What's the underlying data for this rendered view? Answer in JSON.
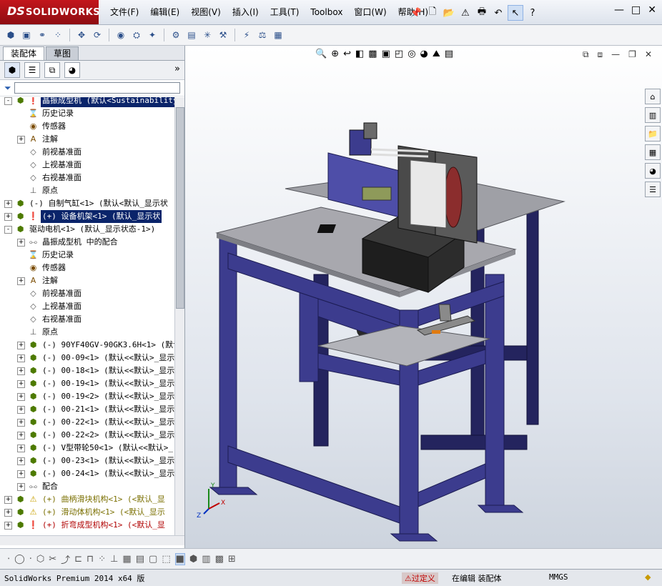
{
  "titlebar": {
    "logo_ds": "DS",
    "logo_text": "SOLIDWORKS",
    "menu": [
      "文件(F)",
      "编辑(E)",
      "视图(V)",
      "插入(I)",
      "工具(T)",
      "Toolbox",
      "窗口(W)",
      "帮助(H)"
    ],
    "window_controls": [
      "—",
      "□",
      "✕"
    ]
  },
  "left_panel": {
    "tabs": [
      "装配体",
      "草图"
    ],
    "more_label": "»",
    "tree": [
      {
        "label": "晶振成型机  (默认<Sustainability",
        "icon": "assembly",
        "expand": "-",
        "indent": 0,
        "selected": true,
        "status": "error"
      },
      {
        "label": "历史记录",
        "icon": "history",
        "expand": "",
        "indent": 1
      },
      {
        "label": "传感器",
        "icon": "sensor",
        "expand": "",
        "indent": 1
      },
      {
        "label": "注解",
        "icon": "annotation",
        "expand": "+",
        "indent": 1
      },
      {
        "label": "前视基准面",
        "icon": "plane",
        "expand": "",
        "indent": 1
      },
      {
        "label": "上视基准面",
        "icon": "plane",
        "expand": "",
        "indent": 1
      },
      {
        "label": "右视基准面",
        "icon": "plane",
        "expand": "",
        "indent": 1
      },
      {
        "label": "原点",
        "icon": "origin",
        "expand": "",
        "indent": 1
      },
      {
        "label": "(-) 自制气缸<1> (默认<默认_显示状",
        "icon": "part",
        "expand": "+",
        "indent": 0
      },
      {
        "label": "(+) 设备机架<1> (默认_显示状",
        "icon": "part",
        "expand": "+",
        "indent": 0,
        "selected": true,
        "status": "error"
      },
      {
        "label": "驱动电机<1> (默认_显示状态-1>)",
        "icon": "part",
        "expand": "-",
        "indent": 0
      },
      {
        "label": "晶振成型机 中的配合",
        "icon": "mates",
        "expand": "+",
        "indent": 1
      },
      {
        "label": "历史记录",
        "icon": "history",
        "expand": "",
        "indent": 1
      },
      {
        "label": "传感器",
        "icon": "sensor",
        "expand": "",
        "indent": 1
      },
      {
        "label": "注解",
        "icon": "annotation",
        "expand": "+",
        "indent": 1
      },
      {
        "label": "前视基准面",
        "icon": "plane",
        "expand": "",
        "indent": 1
      },
      {
        "label": "上视基准面",
        "icon": "plane",
        "expand": "",
        "indent": 1
      },
      {
        "label": "右视基准面",
        "icon": "plane",
        "expand": "",
        "indent": 1
      },
      {
        "label": "原点",
        "icon": "origin",
        "expand": "",
        "indent": 1
      },
      {
        "label": "(-) 90YF40GV-90GK3.6H<1> (默认",
        "icon": "part",
        "expand": "+",
        "indent": 1
      },
      {
        "label": "(-) 00-09<1> (默认<<默认>_显示",
        "icon": "part",
        "expand": "+",
        "indent": 1
      },
      {
        "label": "(-) 00-18<1> (默认<<默认>_显示",
        "icon": "part",
        "expand": "+",
        "indent": 1
      },
      {
        "label": "(-) 00-19<1> (默认<<默认>_显示",
        "icon": "part",
        "expand": "+",
        "indent": 1
      },
      {
        "label": "(-) 00-19<2> (默认<<默认>_显示",
        "icon": "part",
        "expand": "+",
        "indent": 1
      },
      {
        "label": "(-) 00-21<1> (默认<<默认>_显示",
        "icon": "part",
        "expand": "+",
        "indent": 1
      },
      {
        "label": "(-) 00-22<1> (默认<<默认>_显示",
        "icon": "part",
        "expand": "+",
        "indent": 1
      },
      {
        "label": "(-) 00-22<2> (默认<<默认>_显示",
        "icon": "part",
        "expand": "+",
        "indent": 1
      },
      {
        "label": "(-) V型带轮50<1> (默认<<默认>_",
        "icon": "part",
        "expand": "+",
        "indent": 1
      },
      {
        "label": "(-) 00-23<1> (默认<<默认>_显示",
        "icon": "part",
        "expand": "+",
        "indent": 1
      },
      {
        "label": "(-) 00-24<1> (默认<<默认>_显示",
        "icon": "part",
        "expand": "+",
        "indent": 1
      },
      {
        "label": "配合",
        "icon": "mates",
        "expand": "+",
        "indent": 1
      },
      {
        "label": "(+) 曲柄滑块机构<1> (<默认_显",
        "icon": "part-warn",
        "expand": "+",
        "indent": 0,
        "status": "warn"
      },
      {
        "label": "(+) 滑动体机构<1> (<默认_显示",
        "icon": "part-warn",
        "expand": "+",
        "indent": 0,
        "status": "warn"
      },
      {
        "label": "(+) 折弯成型机构<1> (<默认_显",
        "icon": "part-err",
        "expand": "+",
        "indent": 0,
        "status": "err"
      }
    ]
  },
  "status_bar": {
    "product": "SolidWorks Premium 2014 x64 版",
    "over_defined": "过定义",
    "editing": "在编辑 装配体",
    "units": "MMGS"
  },
  "colors": {
    "frame_blue": "#3c3c8e",
    "frame_dark": "#24245e",
    "plate_gray": "#a8a8ae",
    "selection": "#0a246a",
    "brand_red": "#c3161c"
  }
}
